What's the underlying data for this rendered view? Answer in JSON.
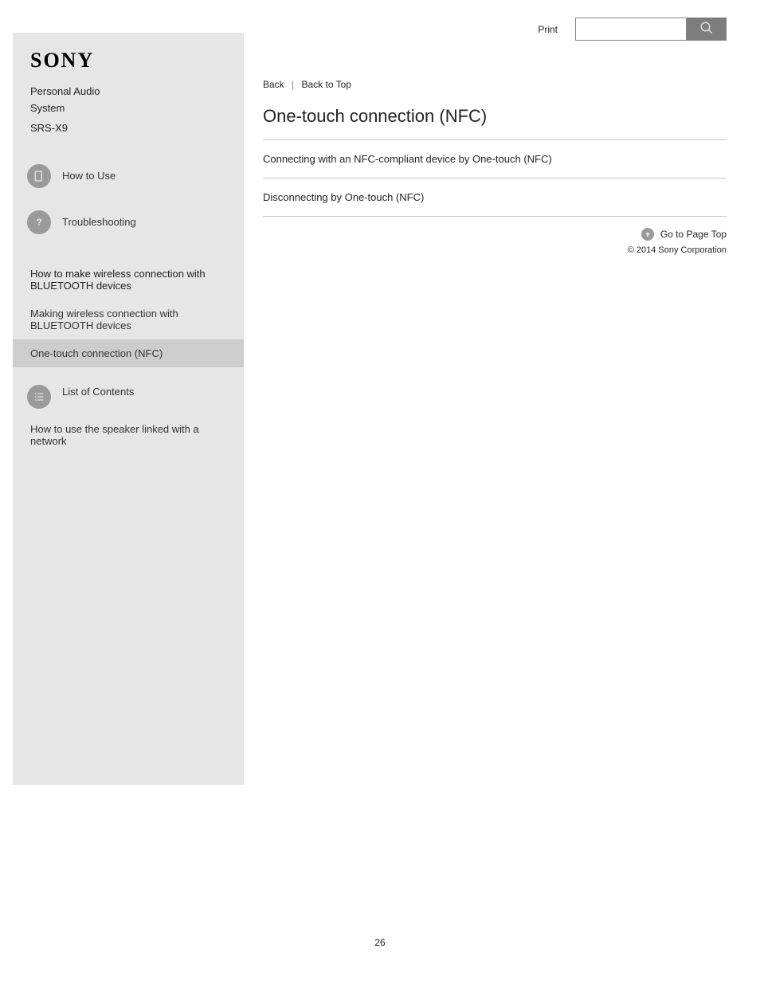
{
  "brand": "SONY",
  "product_line1": "Personal Audio",
  "product_line2": "System",
  "model": "SRS-X9",
  "nav": {
    "how_to_use": "How to Use",
    "troubleshooting": "Troubleshooting"
  },
  "nav_group_header": "How to make wireless connection with BLUETOOTH devices",
  "nav_subs": [
    "Making wireless connection with BLUETOOTH devices",
    "One-touch connection (NFC)",
    "How to use the speaker linked with a network"
  ],
  "list_contents": "List of Contents",
  "breadcrumb": {
    "a": "Back",
    "b": "Back to Top"
  },
  "page_title": "One-touch connection (NFC)",
  "links": [
    "Connecting with an NFC-compliant device by One-touch (NFC)",
    "Disconnecting by One-touch (NFC)"
  ],
  "back_to_top": "Go to Page Top",
  "copyright": "© 2014 Sony Corporation",
  "page_number": "26"
}
